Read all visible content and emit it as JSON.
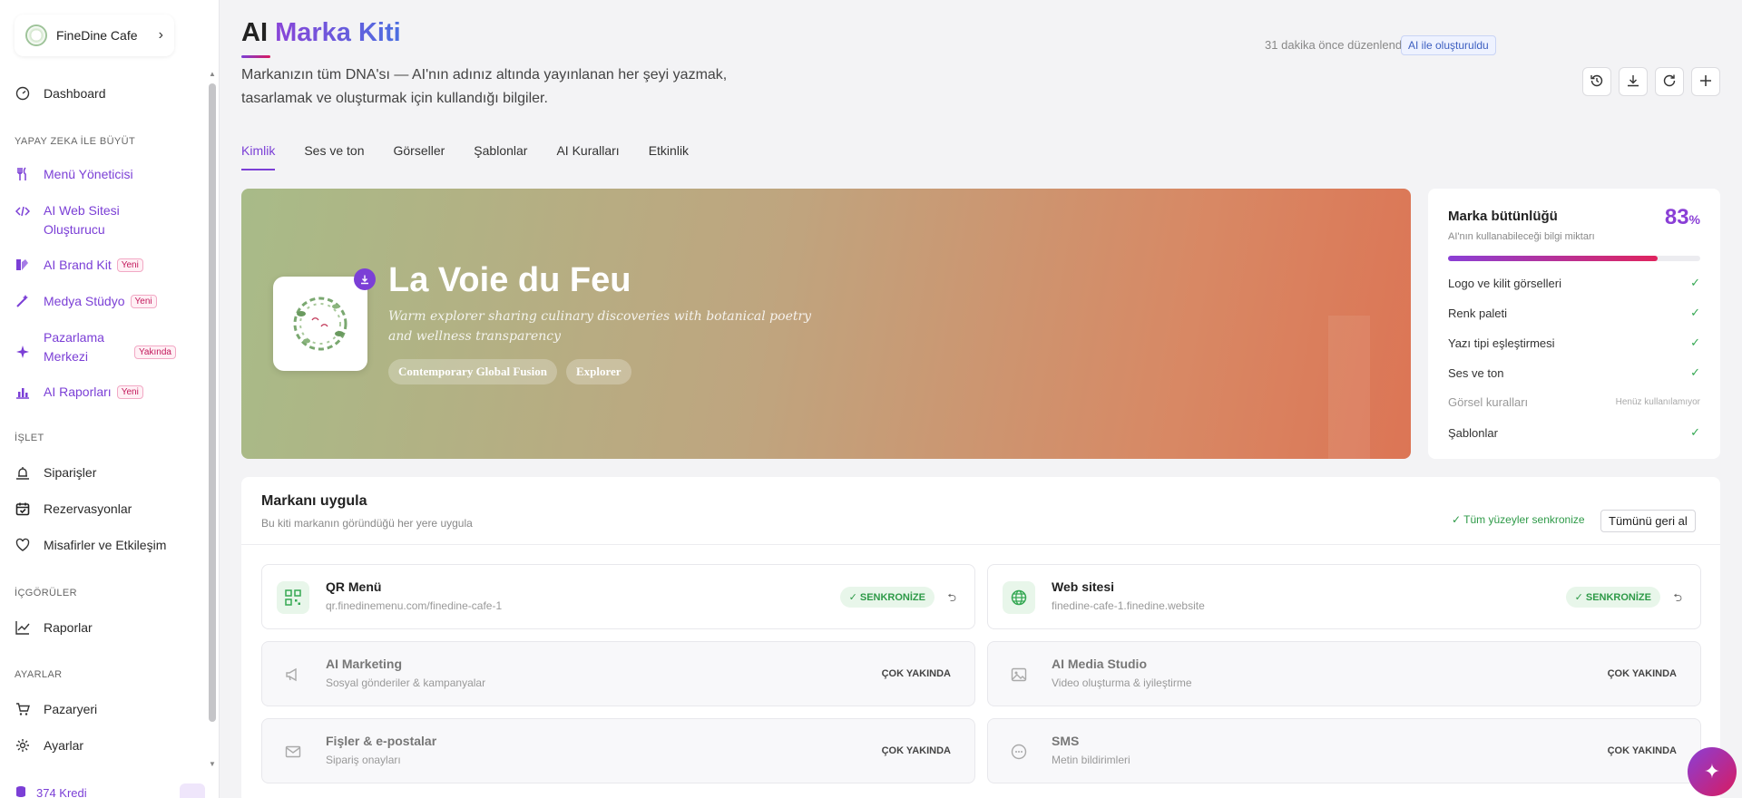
{
  "sidebar": {
    "brand": "FineDine Cafe",
    "dashboard": "Dashboard",
    "sections": {
      "grow": "YAPAY ZEKA İLE BÜYÜT",
      "operate": "İŞLET",
      "insights": "İÇGÖRÜLER",
      "settings": "AYARLAR"
    },
    "items": {
      "menu": "Menü Yöneticisi",
      "website_line1": "AI Web Sitesi",
      "website_line2": "Oluşturucu",
      "brandkit": "AI Brand Kit",
      "media": "Medya Stüdyo",
      "marketing_line1": "Pazarlama",
      "marketing_line2": "Merkezi",
      "reports_ai": "AI Raporları",
      "orders": "Siparişler",
      "reservations": "Rezervasyonlar",
      "guests": "Misafirler ve Etkileşim",
      "reports": "Raporlar",
      "marketplace": "Pazaryeri",
      "settings": "Ayarlar"
    },
    "badges": {
      "new": "Yeni",
      "soon": "Yakında"
    },
    "credits": "374 Kredi"
  },
  "header": {
    "title_plain": "AI",
    "title_accent": "Marka Kiti",
    "subtitle": "Markanızın tüm DNA'sı — AI'nın adınız altında yayınlanan her şeyi yazmak, tasarlamak ve oluşturmak için kullandığı bilgiler.",
    "edited": "31 dakika önce düzenlendi",
    "ai_created": "AI ile oluşturuldu"
  },
  "tabs": [
    "Kimlik",
    "Ses ve ton",
    "Görseller",
    "Şablonlar",
    "AI Kuralları",
    "Etkinlik"
  ],
  "hero": {
    "name": "La Voie du Feu",
    "description": "Warm explorer sharing culinary discoveries with botanical poetry and wellness transparency",
    "tags": [
      "Contemporary Global Fusion",
      "Explorer"
    ]
  },
  "integrity": {
    "title": "Marka bütünlüğü",
    "subtitle": "AI'nın kullanabileceği bilgi miktarı",
    "score": "83",
    "score_unit": "%",
    "progress": 0.83,
    "rows": [
      {
        "label": "Logo ve kilit görselleri",
        "status": "done"
      },
      {
        "label": "Renk paleti",
        "status": "done"
      },
      {
        "label": "Yazı tipi eşleştirmesi",
        "status": "done"
      },
      {
        "label": "Ses ve ton",
        "status": "done"
      },
      {
        "label": "Görsel kuralları",
        "status": "Henüz kullanılamıyor"
      },
      {
        "label": "Şablonlar",
        "status": "done"
      }
    ]
  },
  "apply": {
    "title": "Markanı uygula",
    "subtitle": "Bu kiti markanın göründüğü her yere uygula",
    "sync_all": "Tüm yüzeyler senkronize",
    "revert": "Tümünü geri al",
    "sync_label": "SENKRONİZE",
    "soon_label": "ÇOK YAKINDA",
    "services": [
      {
        "name": "QR Menü",
        "desc": "qr.finedinemenu.com/finedine-cafe-1"
      },
      {
        "name": "Web sitesi",
        "desc": "finedine-cafe-1.finedine.website"
      },
      {
        "name": "AI Marketing",
        "desc": "Sosyal gönderiler & kampanyalar"
      },
      {
        "name": "AI Media Studio",
        "desc": "Video oluşturma & iyileştirme"
      },
      {
        "name": "Fişler & e-postalar",
        "desc": "Sipariş onayları"
      },
      {
        "name": "SMS",
        "desc": "Metin bildirimleri"
      }
    ]
  },
  "colors": {
    "accent": "#7b3fd6",
    "success": "#2e9a48",
    "pink": "#d81b60"
  }
}
